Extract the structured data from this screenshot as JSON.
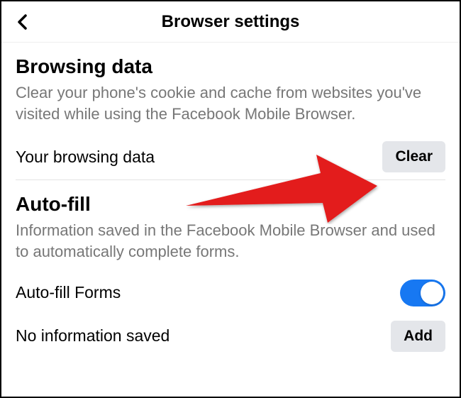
{
  "header": {
    "title": "Browser settings"
  },
  "sections": {
    "browsing_data": {
      "heading": "Browsing data",
      "description": "Clear your phone's cookie and cache from websites you've visited while using the Facebook Mobile Browser.",
      "row_label": "Your browsing data",
      "button_label": "Clear"
    },
    "autofill": {
      "heading": "Auto-fill",
      "description": "Information saved in the Facebook Mobile Browser and used to automatically complete forms.",
      "forms_label": "Auto-fill Forms",
      "forms_toggle_on": true,
      "no_info_label": "No information saved",
      "add_button_label": "Add"
    }
  }
}
